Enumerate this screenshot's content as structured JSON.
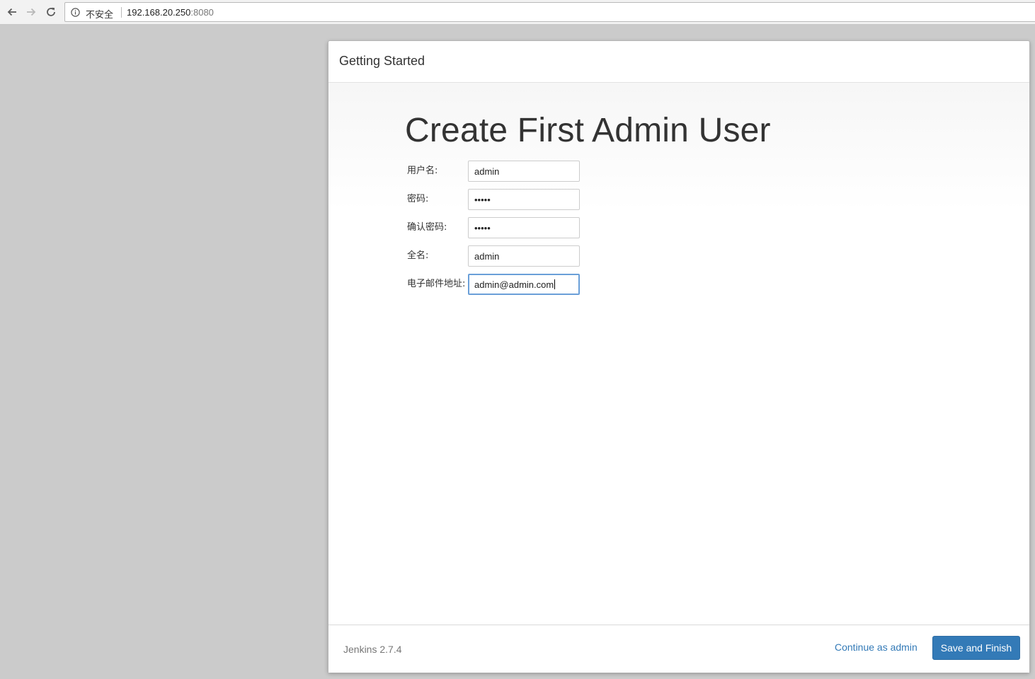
{
  "browser": {
    "security_label": "不安全",
    "url_host": "192.168.20.250",
    "url_port": ":8080",
    "icons": [
      "back-arrow-icon",
      "forward-arrow-icon",
      "reload-icon",
      "info-icon"
    ]
  },
  "dialog": {
    "title": "Getting Started",
    "heading": "Create First Admin User",
    "fields": {
      "username": {
        "label": "用户名:",
        "value": "admin"
      },
      "password": {
        "label": "密码:",
        "value": "•••••"
      },
      "confirm_password": {
        "label": "确认密码:",
        "value": "•••••"
      },
      "full_name": {
        "label": "全名:",
        "value": "admin"
      },
      "email": {
        "label": "电子邮件地址:",
        "value": "admin@admin.com"
      }
    },
    "footer": {
      "version": "Jenkins 2.7.4",
      "continue_label": "Continue as admin",
      "save_label": "Save and Finish"
    }
  },
  "colors": {
    "primary": "#337ab7",
    "focus_border": "#6a9fd8",
    "page_background": "#cbcbcb"
  }
}
